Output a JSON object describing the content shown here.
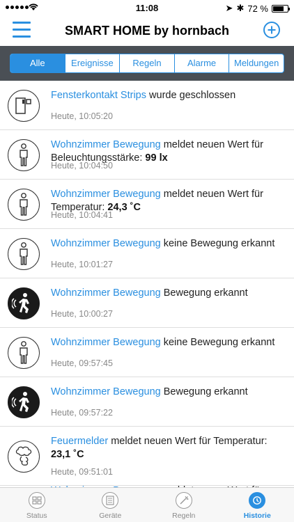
{
  "status_bar": {
    "time": "11:08",
    "battery": "72 %",
    "battery_level": 0.72
  },
  "nav": {
    "title": "SMART HOME by hornbach"
  },
  "filters": [
    "Alle",
    "Ereignisse",
    "Regeln",
    "Alarme",
    "Meldungen"
  ],
  "active_filter": "Alle",
  "events": [
    {
      "icon": "door-contact-icon",
      "dark": false,
      "link": "Fensterkontakt Strips",
      "text": " wurde geschlossen",
      "value": "",
      "time": "Heute, 10:05:20"
    },
    {
      "icon": "person-standing-icon",
      "dark": false,
      "link": "Wohnzimmer Bewegung",
      "text": " meldet neuen Wert für Beleuchtungsstärke: ",
      "value": "99 lx",
      "time": "Heute, 10:04:50"
    },
    {
      "icon": "person-standing-icon",
      "dark": false,
      "link": "Wohnzimmer Bewegung",
      "text": " meldet neuen Wert für Temperatur: ",
      "value": "24,3 ˚C",
      "time": "Heute, 10:04:41"
    },
    {
      "icon": "person-standing-icon",
      "dark": false,
      "link": "Wohnzimmer Bewegung",
      "text": " keine Bewegung erkannt",
      "value": "",
      "time": "Heute, 10:01:27"
    },
    {
      "icon": "person-walking-icon",
      "dark": true,
      "link": "Wohnzimmer Bewegung",
      "text": " Bewegung erkannt",
      "value": "",
      "time": "Heute, 10:00:27"
    },
    {
      "icon": "person-standing-icon",
      "dark": false,
      "link": "Wohnzimmer Bewegung",
      "text": " keine Bewegung erkannt",
      "value": "",
      "time": "Heute, 09:57:45"
    },
    {
      "icon": "person-walking-icon",
      "dark": true,
      "link": "Wohnzimmer Bewegung",
      "text": " Bewegung erkannt",
      "value": "",
      "time": "Heute, 09:57:22"
    },
    {
      "icon": "smoke-detector-icon",
      "dark": false,
      "link": "Feuermelder",
      "text": " meldet neuen Wert für Temperatur: ",
      "value": "23,1 ˚C",
      "time": "Heute, 09:51:01"
    },
    {
      "icon": "person-standing-icon",
      "dark": false,
      "link": "Wohnzimmer Bewegung",
      "text": " meldet neuen Wert für",
      "value": "",
      "time": ""
    }
  ],
  "tabs": [
    {
      "label": "Status",
      "icon": "status-icon",
      "active": false
    },
    {
      "label": "Geräte",
      "icon": "devices-icon",
      "active": false
    },
    {
      "label": "Regeln",
      "icon": "rules-icon",
      "active": false
    },
    {
      "label": "Historie",
      "icon": "history-icon",
      "active": true
    }
  ],
  "colors": {
    "accent": "#2a8fe0",
    "filter_bar": "#4a4f55"
  }
}
